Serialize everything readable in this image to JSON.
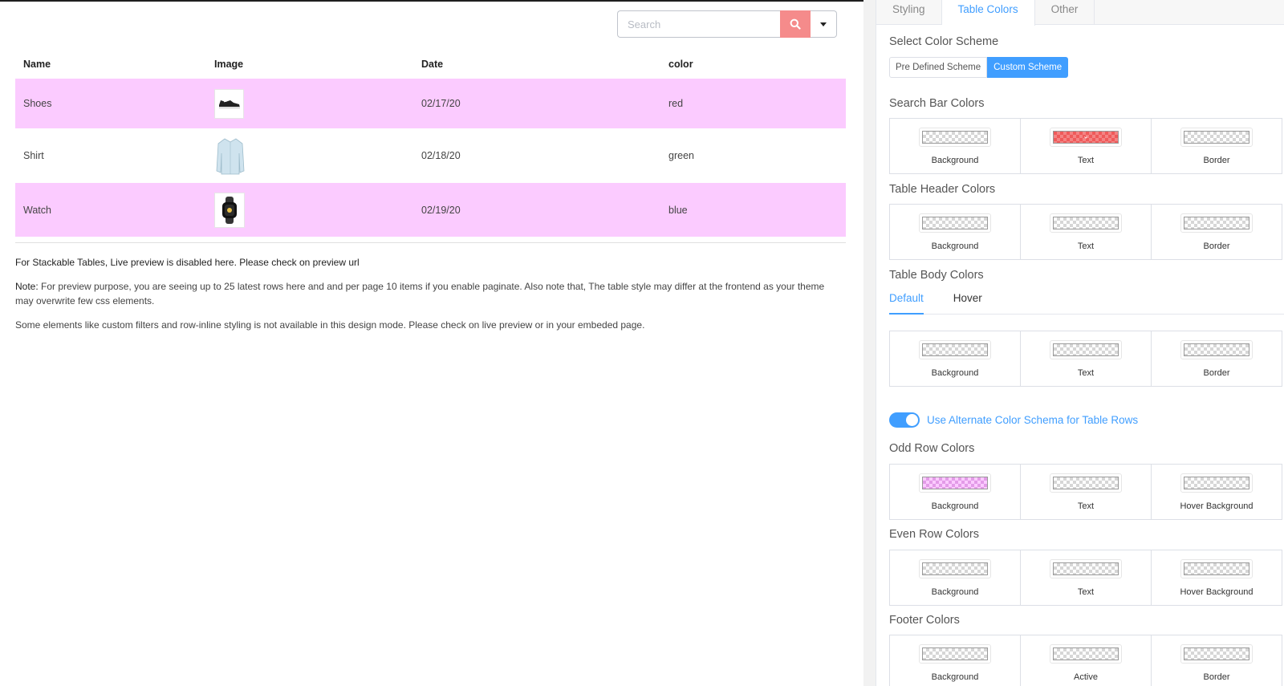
{
  "search": {
    "placeholder": "Search"
  },
  "table": {
    "headers": [
      "Name",
      "Image",
      "Date",
      "color"
    ],
    "rows": [
      {
        "name": "Shoes",
        "image": "shoes-image",
        "date": "02/17/20",
        "color": "red"
      },
      {
        "name": "Shirt",
        "image": "shirt-image",
        "date": "02/18/20",
        "color": "green"
      },
      {
        "name": "Watch",
        "image": "watch-image",
        "date": "02/19/20",
        "color": "blue"
      }
    ],
    "odd_row_color": "#fbcbff"
  },
  "notes": {
    "stackable": "For Stackable Tables, Live preview is disabled here. Please check on preview url",
    "note_label": "Note:",
    "note_text": " For preview purpose, you are seeing up to 25 latest rows here and and per page 10 items if you enable paginate. Also note that, The table style may differ at the frontend as your theme may overwrite few css elements.",
    "elements": "Some elements like custom filters and row-inline styling is not available in this design mode. Please check on live preview or in your embeded page."
  },
  "panel": {
    "tabs": [
      "Styling",
      "Table Colors",
      "Other"
    ],
    "active_tab": "Table Colors",
    "scheme_title": "Select Color Scheme",
    "scheme_buttons": [
      "Pre Defined Scheme",
      "Custom Scheme"
    ],
    "search_bar_title": "Search Bar Colors",
    "search_bar_labels": [
      "Background",
      "Text",
      "Border"
    ],
    "header_title": "Table Header Colors",
    "header_labels": [
      "Background",
      "Text",
      "Border"
    ],
    "body_title": "Table Body Colors",
    "body_subtabs": [
      "Default",
      "Hover"
    ],
    "body_labels": [
      "Background",
      "Text",
      "Border"
    ],
    "alternate_toggle": "Use Alternate Color Schema for Table Rows",
    "odd_title": "Odd Row Colors",
    "odd_labels": [
      "Background",
      "Text",
      "Hover Background"
    ],
    "even_title": "Even Row Colors",
    "even_labels": [
      "Background",
      "Text",
      "Hover Background"
    ],
    "footer_title": "Footer Colors",
    "footer_labels": [
      "Background",
      "Active",
      "Border"
    ]
  },
  "colors": {
    "accent": "#409eff",
    "search_button": "#f58b8b",
    "search_text": "#ef5a5a"
  }
}
